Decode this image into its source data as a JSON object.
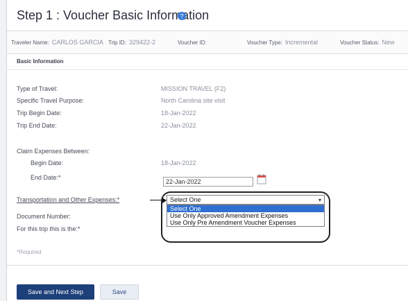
{
  "header": {
    "title": "Step 1 : Voucher Basic Information"
  },
  "info_bar": {
    "traveler_name_label": "Traveler Name:",
    "traveler_name_value": "CARLOS GARCIA",
    "trip_id_label": "Trip ID:",
    "trip_id_value": "329422-2",
    "voucher_id_label": "Voucher ID:",
    "voucher_id_value": "",
    "voucher_type_label": "Voucher Type:",
    "voucher_type_value": "Incremental",
    "voucher_status_label": "Voucher Status:",
    "voucher_status_value": "New"
  },
  "section": {
    "title": "Basic Information"
  },
  "fields": {
    "type_of_travel_label": "Type of Travel:",
    "type_of_travel_value": "MISSION TRAVEL (F2)",
    "purpose_label": "Specific Travel Purpose:",
    "purpose_value": "North Carolina site visit",
    "trip_begin_label": "Trip Begin Date:",
    "trip_begin_value": "18-Jan-2022",
    "trip_end_label": "Trip End Date:",
    "trip_end_value": "22-Jan-2022",
    "claim_between_label": "Claim Expenses Between:",
    "begin_date_label": "Begin Date:",
    "begin_date_value": "18-Jan-2022",
    "end_date_label": "End Date:*",
    "end_date_value": "22-Jan-2022",
    "transport_label": "Transportation and Other Expenses:*",
    "document_number_label": "Document Number:",
    "this_trip_label": "For this trip this is the:*",
    "required_note": "*Required"
  },
  "dropdown": {
    "selected": "Select One",
    "options": [
      "Select One",
      "Use Only Approved Amendment Expenses",
      "Use Only Pre Amendment Voucher Expenses"
    ]
  },
  "buttons": {
    "save_next": "Save and Next Step",
    "save": "Save"
  },
  "colors": {
    "primary": "#1d3f7a",
    "option_highlight": "#2f6fd1"
  },
  "icons": {
    "help": "help-circle-icon",
    "calendar": "calendar-icon",
    "dropdown_arrow": "chevron-down-icon"
  }
}
